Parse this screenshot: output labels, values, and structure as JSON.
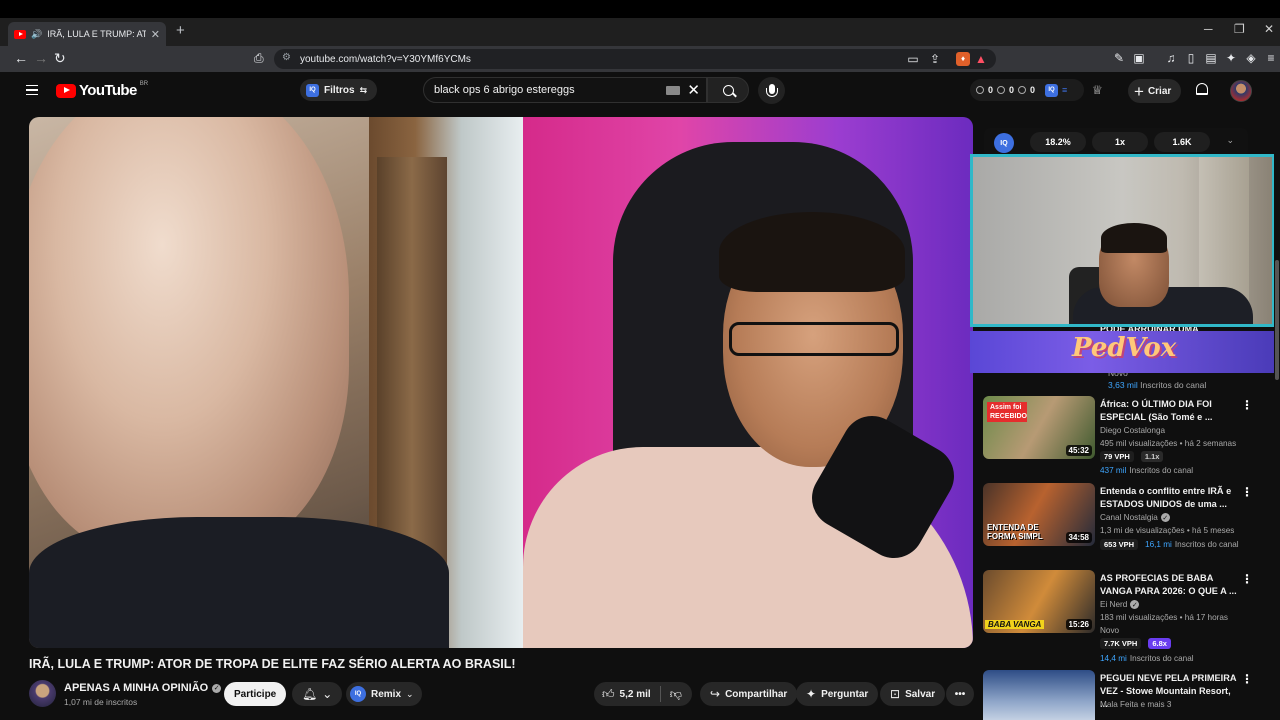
{
  "browser": {
    "tab_title": "IRÃ, LULA E TRUMP: ATOR DE",
    "tab_close": "✕",
    "new_tab": "+",
    "url": "youtube.com/watch?v=Y30YMf6YCMs",
    "window_min": "─",
    "window_max": "❐",
    "window_close": "✕"
  },
  "yt_header": {
    "logo_text": "YouTube",
    "country": "BR",
    "filter_label": "Filtros",
    "search_value": "black ops 6 abrigo estereggs",
    "counter_a": "0",
    "counter_b": "0",
    "counter_c": "0",
    "create_label": "Criar"
  },
  "video": {
    "title": "IRÃ, LULA E TRUMP: ATOR DE TROPA DE ELITE FAZ SÉRIO ALERTA AO BRASIL!",
    "channel": "APENAS A MINHA OPINIÃO",
    "subscribers": "1,07 mi de inscritos",
    "join_label": "Participe",
    "remix_label": "Remix",
    "likes": "5,2 mil",
    "share_label": "Compartilhar",
    "ask_label": "Perguntar",
    "save_label": "Salvar"
  },
  "iq_panel": {
    "badge": "IQ",
    "stat1": "18.2%",
    "stat2": "1x",
    "stat3": "1.6K"
  },
  "overlay": {
    "brand": "PedVox",
    "behind_title": "PODE ARRUINAR UMA",
    "behind_chip": "Novo",
    "behind_subs_num": "3,63 mil",
    "behind_subs_label": "Inscritos do canal"
  },
  "recommendations": [
    {
      "title": "África: O ÚLTIMO DIA FOI ESPECIAL (São Tomé e ...",
      "channel": "Diego Costalonga",
      "meta": "495 mil visualizações • há 2 semanas",
      "vph": "79 VPH",
      "mult": "1.1x",
      "subs_num": "437 mil",
      "subs_label": "Inscritos do canal",
      "duration": "45:32",
      "thumb_text": "Assim foi RECEBIDO"
    },
    {
      "title": "Entenda o conflito entre IRÃ e ESTADOS UNIDOS de uma ...",
      "channel": "Canal Nostalgia",
      "meta": "1,3 mi de visualizações • há 5 meses",
      "vph": "653 VPH",
      "subs_num": "16,1 mi",
      "subs_label": "Inscritos do canal",
      "duration": "34:58",
      "thumb_text": "ENTENDA DE FORMA SIMPL"
    },
    {
      "title": "AS PROFECIAS DE BABA VANGA PARA 2026: O QUE A ...",
      "channel": "Ei Nerd",
      "meta": "183 mil visualizações • há 17 horas",
      "new_chip": "Novo",
      "vph": "7.7K VPH",
      "mult": "6.8x",
      "subs_num": "14,4 mi",
      "subs_label": "Inscritos do canal",
      "duration": "15:26",
      "thumb_text": "BABA VANGA"
    },
    {
      "title": "PEGUEI NEVE PELA PRIMEIRA VEZ - Stowe Mountain Resort, ...",
      "channel": "Mala Feita e mais 3"
    }
  ],
  "icons": {
    "more": "⋮",
    "verified": "✓",
    "chevron_down": "⌄"
  }
}
